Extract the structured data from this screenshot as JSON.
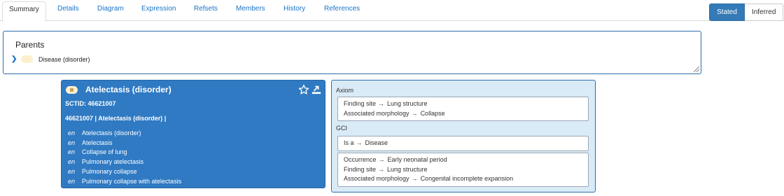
{
  "tabs": [
    {
      "label": "Summary",
      "active": true
    },
    {
      "label": "Details"
    },
    {
      "label": "Diagram"
    },
    {
      "label": "Expression"
    },
    {
      "label": "Refsets"
    },
    {
      "label": "Members"
    },
    {
      "label": "History"
    },
    {
      "label": "References"
    }
  ],
  "view_toggle": {
    "stated": "Stated",
    "inferred": "Inferred",
    "selected": "Stated"
  },
  "parents": {
    "title": "Parents",
    "items": [
      {
        "label": "Disease (disorder)"
      }
    ]
  },
  "concept": {
    "title": "Atelectasis (disorder)",
    "sctid_line": "SCTID: 46621007",
    "fsn_line": "46621007 | Atelectasis (disorder) |",
    "descriptions": [
      {
        "lang": "en",
        "term": "Atelectasis (disorder)"
      },
      {
        "lang": "en",
        "term": "Atelectasis"
      },
      {
        "lang": "en",
        "term": "Collapse of lung"
      },
      {
        "lang": "en",
        "term": "Pulmonary atelectasis"
      },
      {
        "lang": "en",
        "term": "Pulmonary collapse"
      },
      {
        "lang": "en",
        "term": "Pulmonary collapse with atelectasis"
      }
    ],
    "icons": [
      "primitive-badge-icon",
      "star-icon",
      "export-icon"
    ]
  },
  "axioms": {
    "axiom_label": "Axiom",
    "axiom_group": [
      {
        "attr": "Finding site",
        "arrow": "→",
        "value": "Lung structure"
      },
      {
        "attr": "Associated morphology",
        "arrow": "→",
        "value": "Collapse"
      }
    ],
    "gci_label": "GCI",
    "gci_isa": [
      {
        "attr": "Is a",
        "arrow": "→",
        "value": "Disease"
      }
    ],
    "gci_group": [
      {
        "attr": "Occurrence",
        "arrow": "→",
        "value": "Early neonatal period"
      },
      {
        "attr": "Finding site",
        "arrow": "→",
        "value": "Lung structure"
      },
      {
        "attr": "Associated morphology",
        "arrow": "→",
        "value": "Congenital incomplete expansion"
      }
    ]
  },
  "colors": {
    "accent": "#337ab7",
    "card": "#2f7ac3",
    "axiom_bg": "#d9ebf7",
    "badge": "#fdf0cf"
  }
}
